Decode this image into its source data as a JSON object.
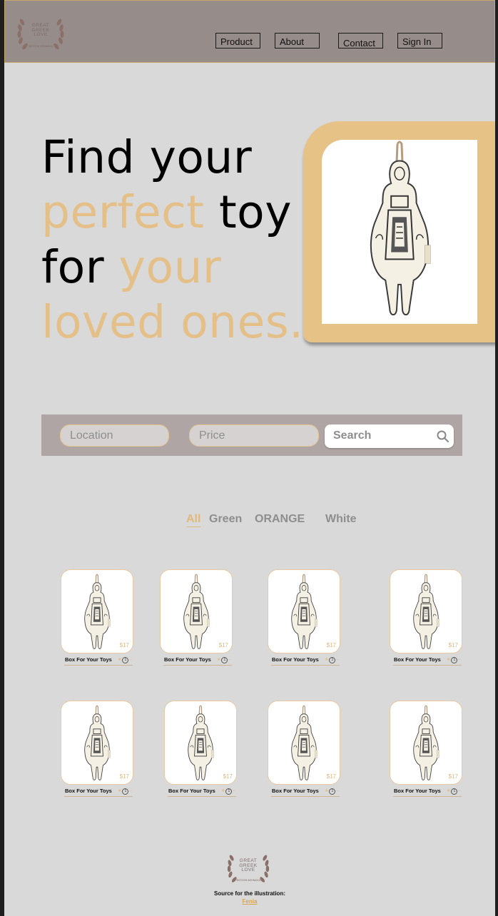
{
  "brand": {
    "logo_line1": "GREAT",
    "logo_line2": "GREEK",
    "logo_line3": "LOVE",
    "logo_subtext": "ΦΩΤΟΘΗ ΑΘΗΝΑΙΚΑ"
  },
  "nav": {
    "items": [
      {
        "label": "Product"
      },
      {
        "label": "About"
      },
      {
        "label": "Contact"
      },
      {
        "label": "Sign In"
      }
    ]
  },
  "hero": {
    "line1": "Find your",
    "line2_accent": "perfect",
    "line2_rest": " toy",
    "line3_start": "for ",
    "line3_accent": "your",
    "line4_accent": "loved ones."
  },
  "search": {
    "location_placeholder": "Location",
    "price_placeholder": "Price",
    "search_placeholder": "Search"
  },
  "filters": [
    {
      "label": "All",
      "active": true
    },
    {
      "label": "Green",
      "active": false
    },
    {
      "label": "ORANGE",
      "active": false
    },
    {
      "label": "White",
      "active": false
    }
  ],
  "products": [
    {
      "name": "Box For Your Toys",
      "price": "$17",
      "rating": "1"
    },
    {
      "name": "Box For Your Toys",
      "price": "$17",
      "rating": "1"
    },
    {
      "name": "Box For Your Toys",
      "price": "$17",
      "rating": "1"
    },
    {
      "name": "Box For Your Toys",
      "price": "$17",
      "rating": "1"
    },
    {
      "name": "Box For Your Toys",
      "price": "$17",
      "rating": "1"
    },
    {
      "name": "Box For Your Toys",
      "price": "$17",
      "rating": "1"
    },
    {
      "name": "Box For Your Toys",
      "price": "$17",
      "rating": "1"
    },
    {
      "name": "Box For Your Toys",
      "price": "$17",
      "rating": "1"
    }
  ],
  "footer": {
    "credit": "Source for the illustration:",
    "link": "Fenia"
  },
  "colors": {
    "accent": "#e4c088",
    "nav_bg": "#968c8a",
    "page_bg": "#d9d9d9",
    "search_bar_bg": "#b0a5a5"
  }
}
